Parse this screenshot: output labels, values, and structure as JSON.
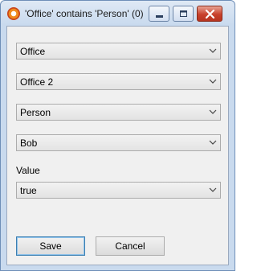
{
  "window": {
    "title": "'Office' contains 'Person' (0)"
  },
  "fields": [
    {
      "selected": "Office"
    },
    {
      "selected": "Office 2"
    },
    {
      "selected": "Person"
    },
    {
      "selected": "Bob"
    }
  ],
  "value_field": {
    "label": "Value",
    "selected": "true"
  },
  "buttons": {
    "save": "Save",
    "cancel": "Cancel"
  },
  "icons": {
    "app": "app-icon",
    "minimize": "minimize-icon",
    "maximize": "maximize-icon",
    "close": "close-icon",
    "dropdown": "chevron-down-icon"
  }
}
